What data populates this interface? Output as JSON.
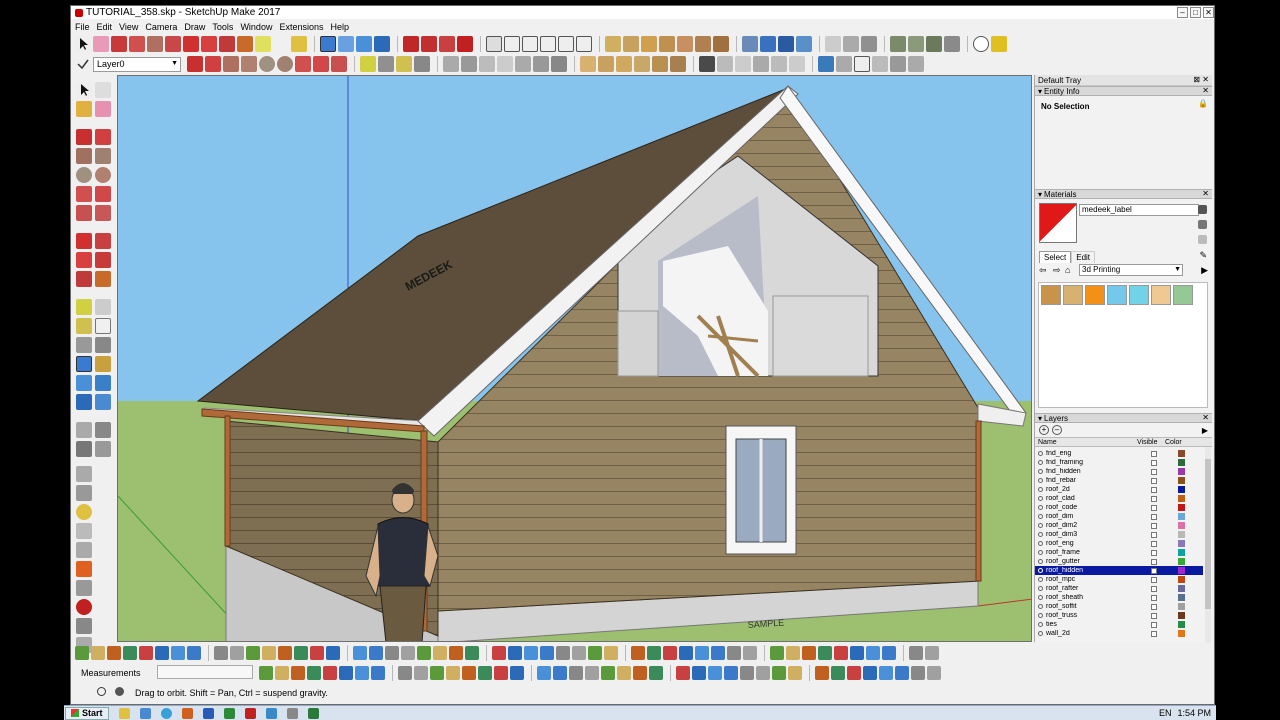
{
  "window": {
    "title": "TUTORIAL_358.skp - SketchUp Make 2017"
  },
  "menu": [
    "File",
    "Edit",
    "View",
    "Camera",
    "Draw",
    "Tools",
    "Window",
    "Extensions",
    "Help"
  ],
  "layer_dropdown": {
    "value": "Layer0"
  },
  "tray": {
    "title": "Default Tray",
    "entity_info": {
      "title": "Entity Info",
      "selection": "No Selection"
    },
    "materials": {
      "title": "Materials",
      "material_name": "medeek_label",
      "swatch_color": "#e01818",
      "tabs": [
        "Select",
        "Edit"
      ],
      "library": "3d Printing",
      "swatches": [
        "#c8944a",
        "#d8b070",
        "#f29018",
        "#74c8ec",
        "#72d2e8",
        "#f0c894",
        "#94c894"
      ]
    },
    "layers": {
      "title": "Layers",
      "col_name": "Name",
      "col_visible": "Visible",
      "col_color": "Color",
      "rows": [
        {
          "name": "fnd_eng",
          "color": "#8a4a2a",
          "selected": false
        },
        {
          "name": "fnd_framing",
          "color": "#2e6b3a",
          "selected": false
        },
        {
          "name": "fnd_hidden",
          "color": "#9a3aa8",
          "selected": false
        },
        {
          "name": "fnd_rebar",
          "color": "#8a5020",
          "selected": false
        },
        {
          "name": "roof_2d",
          "color": "#0a1aa0",
          "selected": false
        },
        {
          "name": "roof_clad",
          "color": "#c06018",
          "selected": false
        },
        {
          "name": "roof_code",
          "color": "#c01818",
          "selected": false
        },
        {
          "name": "roof_dim",
          "color": "#6aa8d8",
          "selected": false
        },
        {
          "name": "roof_dim2",
          "color": "#e070a8",
          "selected": false
        },
        {
          "name": "roof_dim3",
          "color": "#b8b8b8",
          "selected": false
        },
        {
          "name": "roof_eng",
          "color": "#8a78b8",
          "selected": false
        },
        {
          "name": "roof_frame",
          "color": "#10a0a0",
          "selected": false
        },
        {
          "name": "roof_gutter",
          "color": "#38a838",
          "selected": false
        },
        {
          "name": "roof_hidden",
          "color": "#a028c8",
          "selected": true
        },
        {
          "name": "roof_mpc",
          "color": "#c04810",
          "selected": false
        },
        {
          "name": "roof_rafter",
          "color": "#6a6a9a",
          "selected": false
        },
        {
          "name": "roof_sheath",
          "color": "#5a7090",
          "selected": false
        },
        {
          "name": "roof_soffit",
          "color": "#a0a0a0",
          "selected": false
        },
        {
          "name": "roof_truss",
          "color": "#6a3a1a",
          "selected": false
        },
        {
          "name": "ties",
          "color": "#2a8a4a",
          "selected": false
        },
        {
          "name": "wall_2d",
          "color": "#e07818",
          "selected": false
        }
      ]
    }
  },
  "scene": {
    "roof_text": "MEDEEK",
    "foundation_text": "SAMPLE"
  },
  "status": {
    "measurements_label": "Measurements",
    "hint": "Drag to orbit. Shift = Pan, Ctrl = suspend gravity."
  },
  "taskbar": {
    "start": "Start",
    "language": "EN",
    "time": "1:54 PM"
  }
}
